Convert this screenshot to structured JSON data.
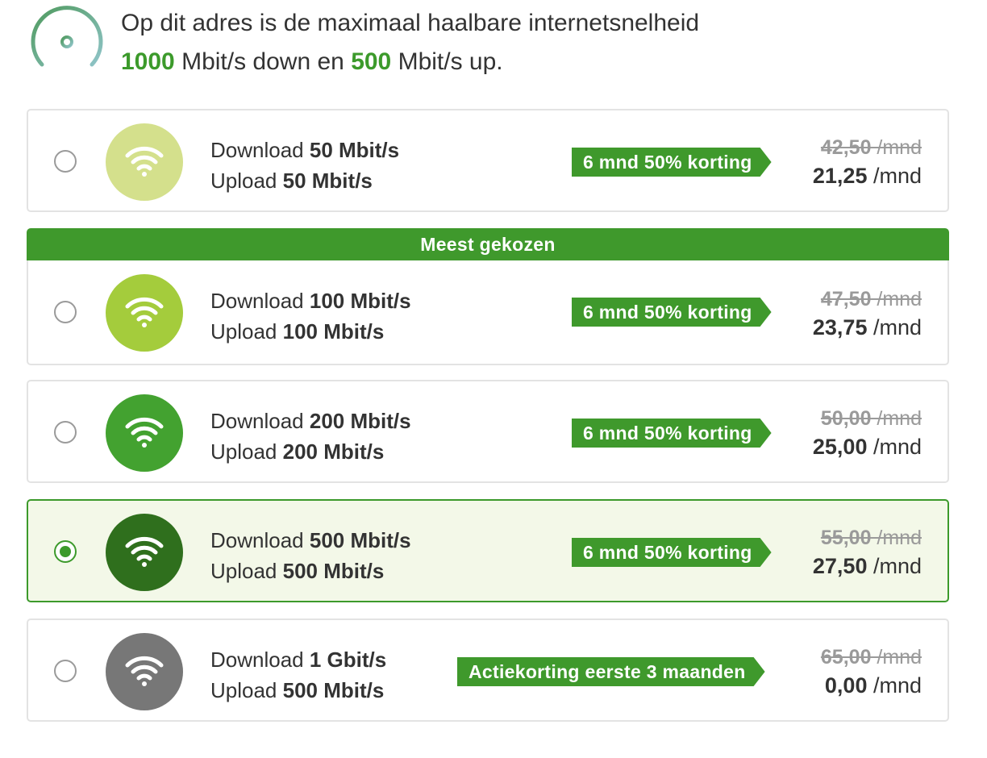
{
  "header": {
    "line1": "Op dit adres is de maximaal haalbare internetsnelheid",
    "down_value": "1000",
    "down_text": " Mbit/s down en ",
    "up_value": "500",
    "up_text": " Mbit/s up."
  },
  "banner": {
    "label": "Meest gekozen"
  },
  "colors": {
    "accent": "#3f992c",
    "plan1": "#d4e08c",
    "plan2": "#a4cc3c",
    "plan3": "#43a230",
    "plan4": "#2f6f1d",
    "plan5": "#777777",
    "selected_bg": "#f3f8e8"
  },
  "plans": [
    {
      "download_label": "Download ",
      "download_value": "50 Mbit/s",
      "upload_label": "Upload ",
      "upload_value": "50 Mbit/s",
      "promo": "6 mnd 50% korting",
      "price_old": "42,50",
      "price_new": "21,25",
      "unit": " /mnd",
      "selected": false,
      "icon": "wifi-icon"
    },
    {
      "download_label": "Download ",
      "download_value": "100 Mbit/s",
      "upload_label": "Upload ",
      "upload_value": "100 Mbit/s",
      "promo": "6 mnd 50% korting",
      "price_old": "47,50",
      "price_new": "23,75",
      "unit": " /mnd",
      "selected": false,
      "icon": "wifi-icon"
    },
    {
      "download_label": "Download ",
      "download_value": "200 Mbit/s",
      "upload_label": "Upload ",
      "upload_value": "200 Mbit/s",
      "promo": "6 mnd 50% korting",
      "price_old": "50,00",
      "price_new": "25,00",
      "unit": " /mnd",
      "selected": false,
      "icon": "wifi-icon"
    },
    {
      "download_label": "Download ",
      "download_value": "500 Mbit/s",
      "upload_label": "Upload ",
      "upload_value": "500 Mbit/s",
      "promo": "6 mnd 50% korting",
      "price_old": "55,00",
      "price_new": "27,50",
      "unit": " /mnd",
      "selected": true,
      "icon": "wifi-icon"
    },
    {
      "download_label": "Download ",
      "download_value": "1 Gbit/s",
      "upload_label": "Upload ",
      "upload_value": "500 Mbit/s",
      "promo": "Actiekorting eerste 3 maanden",
      "price_old": "65,00",
      "price_new": "0,00",
      "unit": " /mnd",
      "selected": false,
      "icon": "wifi-icon"
    }
  ]
}
